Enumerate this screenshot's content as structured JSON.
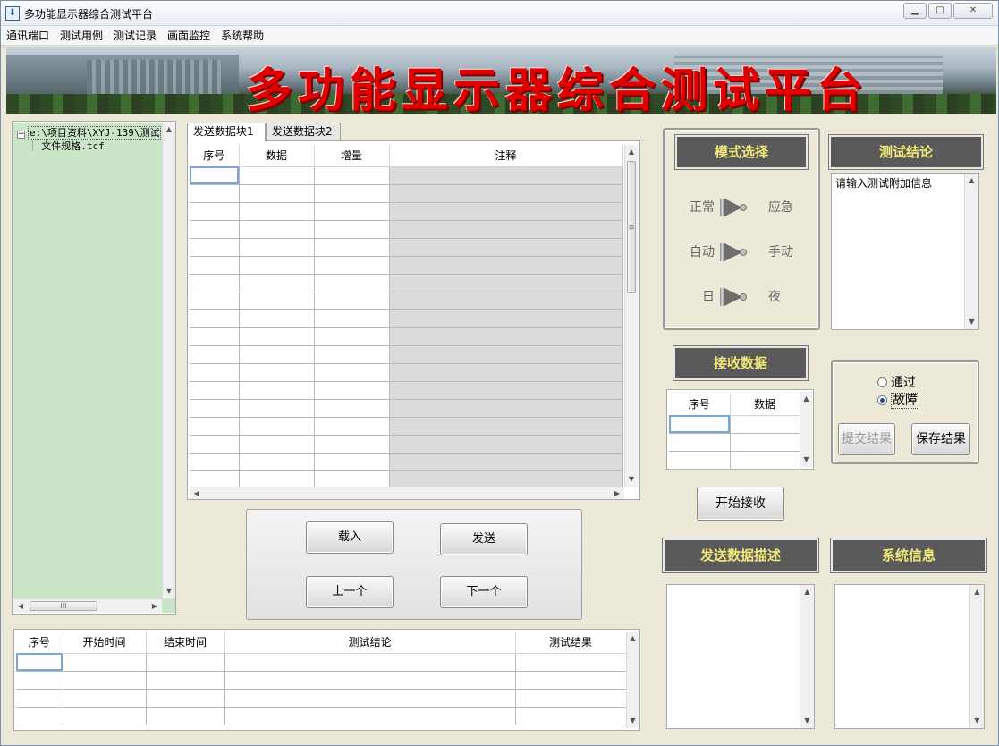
{
  "window": {
    "title": "多功能显示器综合测试平台",
    "controls": [
      "▁",
      "□",
      "✕"
    ]
  },
  "menu": [
    "通讯端口",
    "测试用例",
    "测试记录",
    "画面监控",
    "系统帮助"
  ],
  "banner": {
    "title": "多功能显示器综合测试平台"
  },
  "tree": {
    "root": "e:\\项目资料\\XYJ-139\\测试",
    "child": "文件规格.tcf",
    "expander": "−"
  },
  "send": {
    "tabs": [
      "发送数据块1",
      "发送数据块2"
    ],
    "columns": [
      "序号",
      "数据",
      "增量",
      "注释"
    ],
    "row_count": 18,
    "buttons": {
      "load": "载入",
      "send": "发送",
      "prev": "上一个",
      "next": "下一个"
    }
  },
  "mode": {
    "header": "模式选择",
    "rows": [
      {
        "left": "正常",
        "right": "应急"
      },
      {
        "left": "自动",
        "right": "手动"
      },
      {
        "left": "日",
        "right": "夜"
      }
    ]
  },
  "conclusion": {
    "header": "测试结论",
    "placeholder": "请输入测试附加信息"
  },
  "receive": {
    "header": "接收数据",
    "columns": [
      "序号",
      "数据"
    ],
    "row_count": 3,
    "start_button": "开始接收"
  },
  "result": {
    "options": [
      {
        "label": "通过",
        "selected": false
      },
      {
        "label": "故障",
        "selected": true
      }
    ],
    "submit_button": "提交结果",
    "save_button": "保存结果"
  },
  "send_desc": {
    "header": "发送数据描述"
  },
  "sysinfo": {
    "header": "系统信息"
  },
  "records": {
    "columns": [
      "序号",
      "开始时间",
      "结束时间",
      "测试结论",
      "测试结果"
    ],
    "row_count": 4
  },
  "scroll": {
    "up": "▲",
    "down": "▼",
    "left": "◀",
    "right": "▶",
    "grip": "≡",
    "hgrip": "III"
  },
  "colors": {
    "panel_green": "#cbe5c8",
    "header_dark": "#5a5a5a",
    "header_text": "#f2e87a",
    "banner_title": "#e00000"
  }
}
